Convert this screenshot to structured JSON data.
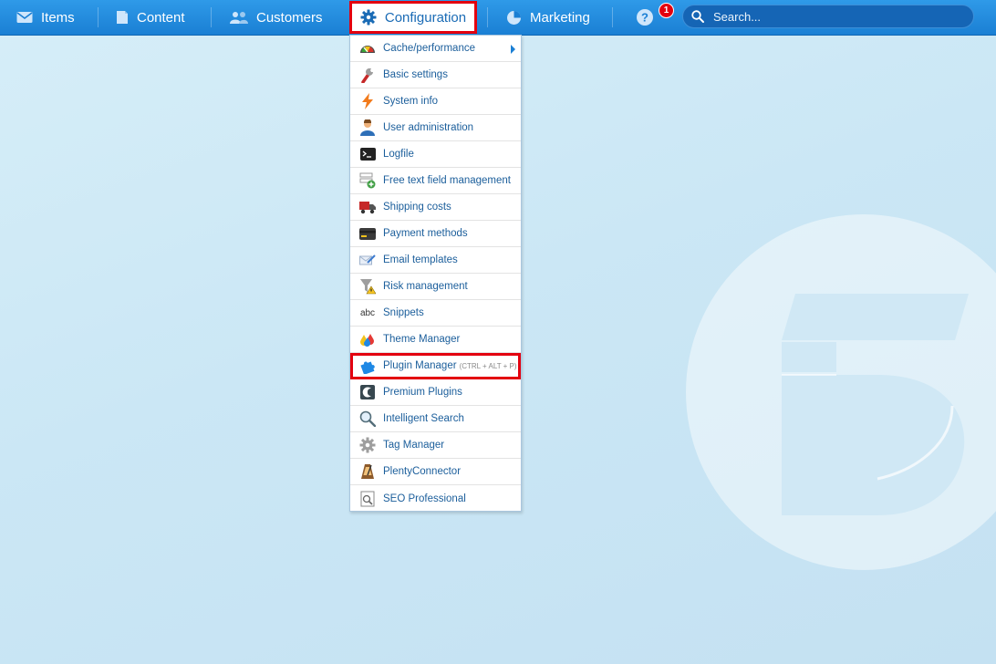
{
  "nav": {
    "items_label": "Items",
    "content_label": "Content",
    "customers_label": "Customers",
    "configuration_label": "Configuration",
    "marketing_label": "Marketing",
    "notification_count": "1",
    "search_placeholder": "Search..."
  },
  "menu": {
    "items": [
      {
        "label": "Cache/performance",
        "icon": "speedometer-icon",
        "has_submenu": true
      },
      {
        "label": "Basic settings",
        "icon": "wrench-icon"
      },
      {
        "label": "System info",
        "icon": "lightning-icon"
      },
      {
        "label": "User administration",
        "icon": "user-icon"
      },
      {
        "label": "Logfile",
        "icon": "terminal-icon"
      },
      {
        "label": "Free text field management",
        "icon": "fields-add-icon"
      },
      {
        "label": "Shipping costs",
        "icon": "truck-icon"
      },
      {
        "label": "Payment methods",
        "icon": "credit-card-icon"
      },
      {
        "label": "Email templates",
        "icon": "email-icon"
      },
      {
        "label": "Risk management",
        "icon": "filter-warning-icon"
      },
      {
        "label": "Snippets",
        "icon": "abc-icon"
      },
      {
        "label": "Theme Manager",
        "icon": "color-drops-icon"
      },
      {
        "label": "Plugin Manager",
        "shortcut": "(CTRL + ALT + P)",
        "icon": "puzzle-icon",
        "highlighted": true
      },
      {
        "label": "Premium Plugins",
        "icon": "shopware-icon"
      },
      {
        "label": "Intelligent Search",
        "icon": "magnifier-icon"
      },
      {
        "label": "Tag Manager",
        "icon": "gear-icon"
      },
      {
        "label": "PlentyConnector",
        "icon": "metronome-icon"
      },
      {
        "label": "SEO Professional",
        "icon": "seo-icon"
      }
    ],
    "snippets_glyph": "abc"
  },
  "colors": {
    "topbar": "#1f86d9",
    "highlight_border": "#e3000f",
    "menu_text": "#1b5e9b"
  }
}
